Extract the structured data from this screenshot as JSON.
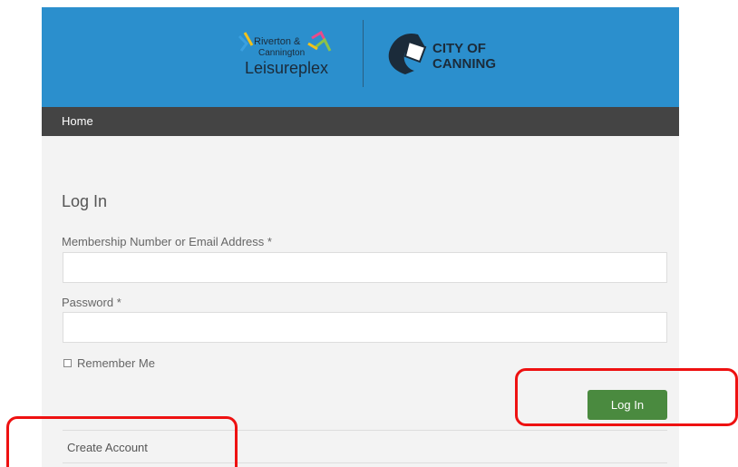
{
  "header": {
    "logo_left": {
      "line1": "Riverton &",
      "line2": "Cannington",
      "line3": "Leisureplex"
    },
    "logo_right": {
      "line1": "CITY OF",
      "line2": "CANNING"
    },
    "background": "#2b8fcd"
  },
  "nav": {
    "home": "Home"
  },
  "form": {
    "title": "Log In",
    "username_label": "Membership Number or Email Address *",
    "username_value": "",
    "password_label": "Password *",
    "password_value": "",
    "remember_label": "Remember Me",
    "remember_checked": false,
    "submit_label": "Log In",
    "submit_color": "#4a8a3f"
  },
  "links": {
    "create_account": "Create Account"
  },
  "annotations": {
    "color": "#ee1111"
  }
}
